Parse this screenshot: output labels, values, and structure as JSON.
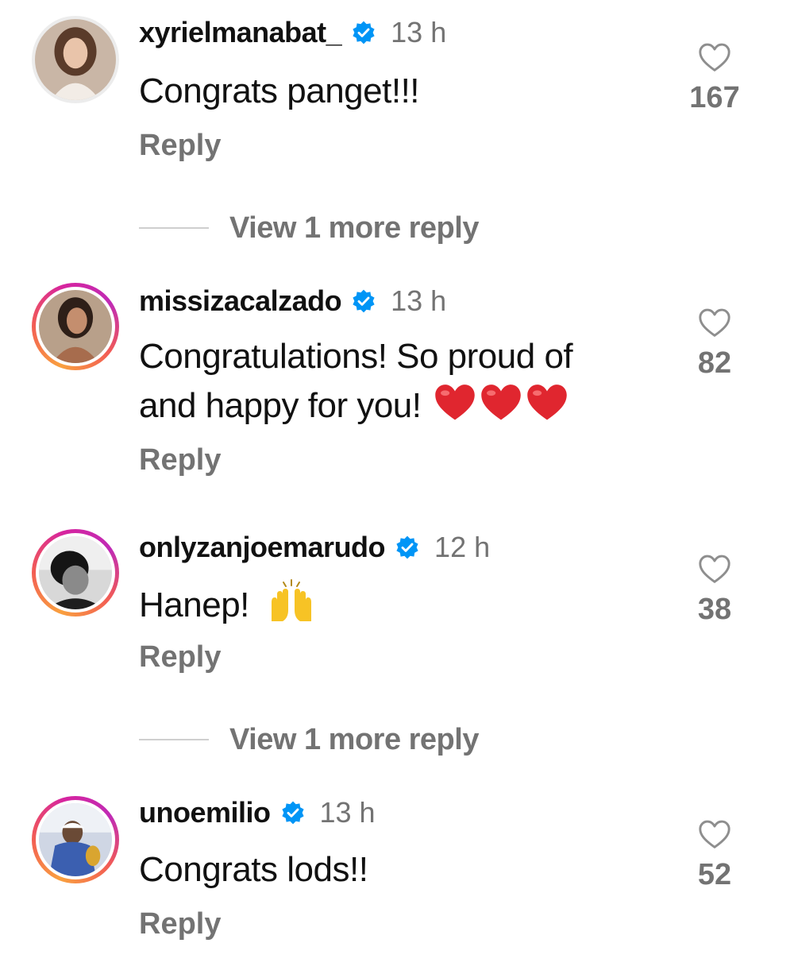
{
  "comments": [
    {
      "username": "xyrielmanabat_",
      "verified": true,
      "time": "13 h",
      "text": "Congrats panget!!!",
      "reply_label": "Reply",
      "likes": "167",
      "avatar_ring": false
    },
    {
      "username": "missizacalzado",
      "verified": true,
      "time": "13 h",
      "text_line1": "Congratulations! So proud of",
      "text_line2": "and happy for you!",
      "emoji": [
        "red-heart",
        "red-heart",
        "red-heart"
      ],
      "reply_label": "Reply",
      "likes": "82",
      "avatar_ring": true
    },
    {
      "username": "onlyzanjoemarudo",
      "verified": true,
      "time": "12 h",
      "text": "Hanep!",
      "emoji": [
        "raising-hands"
      ],
      "reply_label": "Reply",
      "likes": "38",
      "avatar_ring": true
    },
    {
      "username": "unoemilio",
      "verified": true,
      "time": "13 h",
      "text": "Congrats lods!!",
      "reply_label": "Reply",
      "likes": "52",
      "avatar_ring": true
    }
  ],
  "view_more_replies": [
    {
      "label": "View 1 more reply"
    },
    {
      "label": "View 1 more reply"
    }
  ],
  "colors": {
    "verified_badge": "#0095f6",
    "secondary_text": "#737373",
    "heart_emoji": "#e0262f",
    "story_ring": "#d6249f"
  }
}
